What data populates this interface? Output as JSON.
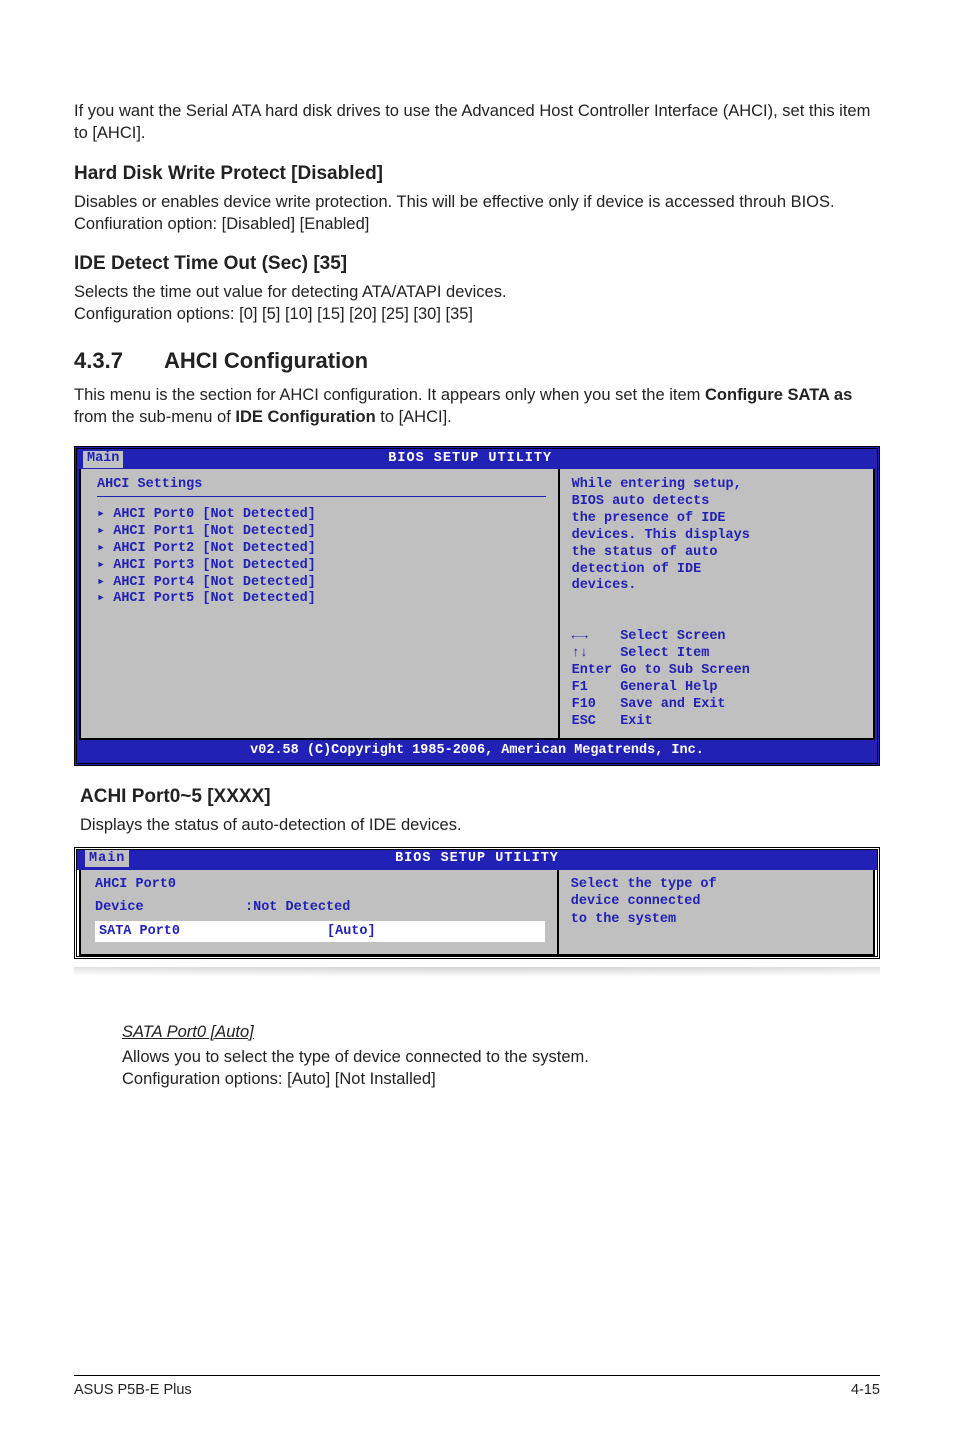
{
  "intro1": "If you want the Serial ATA hard disk drives to use the Advanced Host Controller Interface (AHCI), set this item to [AHCI].",
  "hdwp": {
    "title": "Hard Disk Write Protect [Disabled]",
    "body": "Disables or enables device write protection. This will be effective only if device is accessed throuh BIOS. Confiuration option: [Disabled] [Enabled]"
  },
  "ide_to": {
    "title": "IDE Detect Time Out (Sec) [35]",
    "line1": "Selects the time out value for detecting ATA/ATAPI devices.",
    "line2": "Configuration options: [0] [5] [10] [15] [20] [25] [30] [35]"
  },
  "sec": {
    "num": "4.3.7",
    "title": "AHCI Configuration",
    "body_pre": "This menu is the section for AHCI configuration. It appears only when you set the item ",
    "bold1": "Configure SATA as",
    "mid": " from the sub-menu of ",
    "bold2": "IDE Configuration",
    "post": " to [AHCI]."
  },
  "bios1": {
    "util_title": "BIOS SETUP UTILITY",
    "tab": "Main",
    "heading": "AHCI Settings",
    "items": [
      "AHCI Port0 [Not Detected]",
      "AHCI Port1 [Not Detected]",
      "AHCI Port2 [Not Detected]",
      "AHCI Port3 [Not Detected]",
      "AHCI Port4 [Not Detected]",
      "AHCI Port5 [Not Detected]"
    ],
    "help": "While entering setup,\nBIOS auto detects\nthe presence of IDE\ndevices. This displays\nthe status of auto\ndetection of IDE\ndevices.",
    "keys": "←→    Select Screen\n↑↓    Select Item\nEnter Go to Sub Screen\nF1    General Help\nF10   Save and Exit\nESC   Exit",
    "footer": "v02.58 (C)Copyright 1985-2006, American Megatrends, Inc."
  },
  "achi": {
    "title": "ACHI Port0~5 [XXXX]",
    "body": "Displays the status of auto-detection of IDE devices."
  },
  "bios2": {
    "util_title": "BIOS SETUP UTILITY",
    "tab": "Main",
    "heading": "AHCI Port0",
    "device_lbl": "Device",
    "device_val": ":Not Detected",
    "sel_lbl": "SATA Port0",
    "sel_val": "[Auto]",
    "help": "Select the type of\ndevice connected\nto the system"
  },
  "sata": {
    "title": "SATA Port0 [Auto]",
    "line1": "Allows you to select the type of device connected to the system.",
    "line2": "Configuration options: [Auto] [Not Installed]"
  },
  "footer": {
    "left": "ASUS P5B-E Plus",
    "right": "4-15"
  }
}
